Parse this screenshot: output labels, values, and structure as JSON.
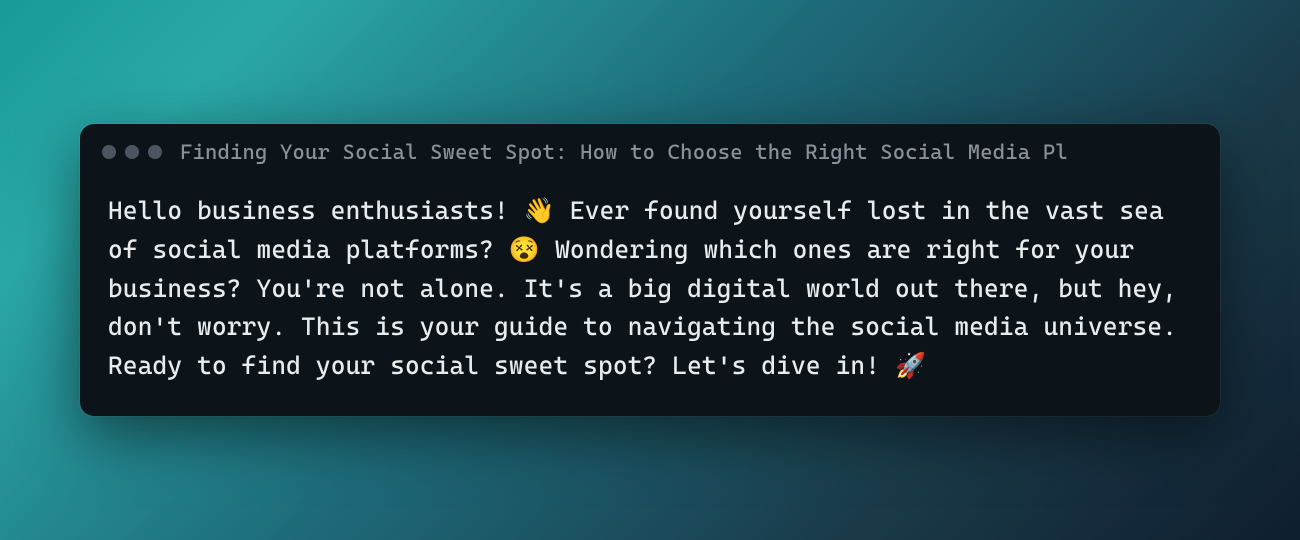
{
  "window": {
    "title": "Finding Your Social Sweet Spot: How to Choose the Right Social Media Pl"
  },
  "content": {
    "body": "Hello business enthusiasts! 👋 Ever found yourself lost in the vast sea of social media platforms? 😵 Wondering which ones are right for your business? You're not alone. It's a big digital world out there, but hey, don't worry. This is your guide to navigating the social media universe. Ready to find your social sweet spot? Let's dive in! 🚀"
  }
}
